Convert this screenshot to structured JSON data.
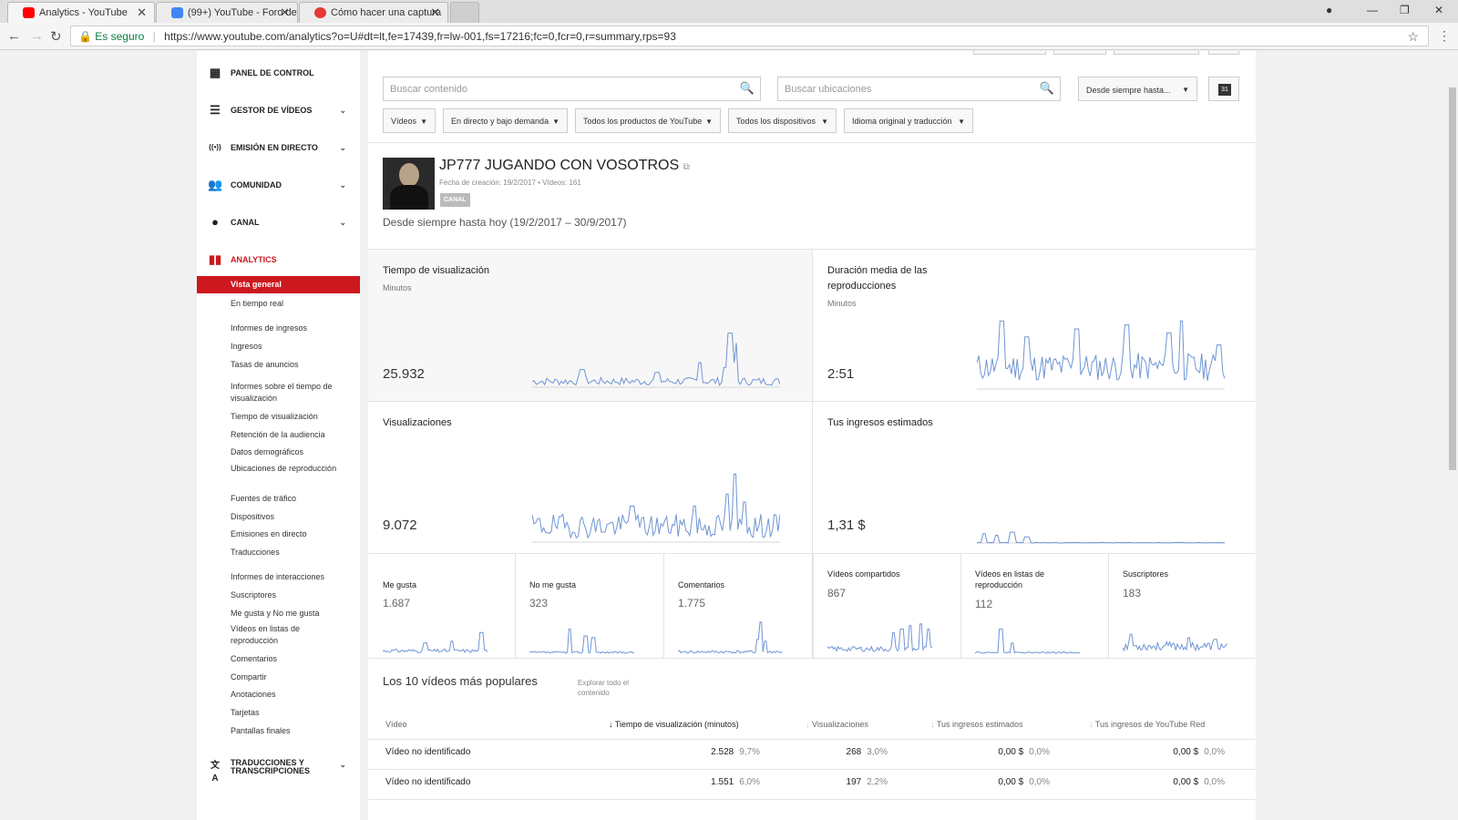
{
  "browser": {
    "tabs": [
      {
        "title": "Analytics - YouTube",
        "icon": "youtube-icon",
        "color": "#ff0000"
      },
      {
        "title": "(99+) YouTube - Foro de",
        "icon": "google-forum-icon",
        "color": "#4285f4"
      },
      {
        "title": "Cómo hacer una captura",
        "icon": "help-icon",
        "color": "#e53935"
      }
    ],
    "secure_label": "Es seguro",
    "url": "https://www.youtube.com/analytics?o=U#dt=lt,fe=17439,fr=lw-001,fs=17216;fc=0,fcr=0,r=summary,rps=93"
  },
  "sidebar": {
    "sections": [
      {
        "label": "PANEL DE CONTROL",
        "icon": "dashboard-icon",
        "glyph": "▦",
        "chevron": ""
      },
      {
        "label": "GESTOR DE VÍDEOS",
        "icon": "video-manager-icon",
        "glyph": "☰",
        "chevron": "⌄"
      },
      {
        "label": "EMISIÓN EN DIRECTO",
        "icon": "live-broadcast-icon",
        "glyph": "((•))",
        "chevron": "⌄"
      },
      {
        "label": "COMUNIDAD",
        "icon": "community-icon",
        "glyph": "👥",
        "chevron": "⌄"
      },
      {
        "label": "CANAL",
        "icon": "channel-icon",
        "glyph": "●",
        "chevron": "⌄"
      },
      {
        "label": "ANALYTICS",
        "icon": "analytics-icon",
        "glyph": "▮▮",
        "chevron": ""
      }
    ],
    "analytics_items": [
      "Vista general",
      "En tiempo real",
      "Informes de ingresos",
      "Ingresos",
      "Tasas de anuncios",
      "Informes sobre el tiempo de visualización",
      "Tiempo de visualización",
      "Retención de la audiencia",
      "Datos demográficos",
      "Ubicaciones de reproducción",
      "Fuentes de tráfico",
      "Dispositivos",
      "Emisiones en directo",
      "Traducciones",
      "Informes de interacciones",
      "Suscriptores",
      "Me gusta y No me gusta",
      "Vídeos en listas de reproducción",
      "Comentarios",
      "Compartir",
      "Anotaciones",
      "Tarjetas",
      "Pantallas finales"
    ],
    "translations": {
      "label": "TRADUCCIONES Y TRANSCRIPCIONES",
      "icon": "translate-icon",
      "glyph": "文A",
      "chevron": "⌄"
    },
    "accent": "#cc181e"
  },
  "filters": {
    "search_content_placeholder": "Buscar contenido",
    "search_locations_placeholder": "Buscar ubicaciones",
    "date_dropdown": "Desde siempre hasta...",
    "calendar_day": "31",
    "dropdowns": [
      "Vídeos",
      "En directo y bajo demanda",
      "Todos los productos de YouTube",
      "Todos los dispositivos",
      "Idioma original y traducción"
    ]
  },
  "channel": {
    "name": "JP777 JUGANDO CON VOSOTROS",
    "meta": "Fecha de creación: 19/2/2017  •  Vídeos: 161",
    "badge": "CANAL",
    "date_range": "Desde siempre hasta hoy (19/2/2017 – 30/9/2017)"
  },
  "panels": [
    {
      "title": "Tiempo de visualización",
      "subtitle": "Minutos",
      "value": "25.932"
    },
    {
      "title": "Duración media de las reproducciones",
      "subtitle": "Minutos",
      "value": "2:51"
    },
    {
      "title": "Visualizaciones",
      "subtitle": "",
      "value": "9.072"
    },
    {
      "title": "Tus ingresos estimados",
      "subtitle": "",
      "value": "1,31 $"
    }
  ],
  "metrics": [
    {
      "name": "Me gusta",
      "value": "1.687"
    },
    {
      "name": "No me gusta",
      "value": "323"
    },
    {
      "name": "Comentarios",
      "value": "1.775"
    },
    {
      "name": "Vídeos compartidos",
      "value": "867"
    },
    {
      "name": "Vídeos en listas de reproducción",
      "value": "112"
    },
    {
      "name": "Suscriptores",
      "value": "183"
    }
  ],
  "top_videos": {
    "title": "Los 10 vídeos más populares",
    "explore": "Explorar todo el contenido",
    "headers": [
      "Vídeo",
      "Tiempo de visualización (minutos)",
      "Visualizaciones",
      "Tus ingresos estimados",
      "Tus ingresos de YouTube Red"
    ],
    "rows": [
      {
        "video": "Vídeo no identificado",
        "watch": "2.528",
        "watch_pct": "9,7%",
        "views": "268",
        "views_pct": "3,0%",
        "revenue": "0,00 $",
        "revenue_pct": "0,0%",
        "red": "0,00 $",
        "red_pct": "0,0%"
      },
      {
        "video": "Vídeo no identificado",
        "watch": "1.551",
        "watch_pct": "6,0%",
        "views": "197",
        "views_pct": "2,2%",
        "revenue": "0,00 $",
        "revenue_pct": "0,0%",
        "red": "0,00 $",
        "red_pct": "0,0%"
      }
    ]
  },
  "chart_color": "#6f95d4"
}
